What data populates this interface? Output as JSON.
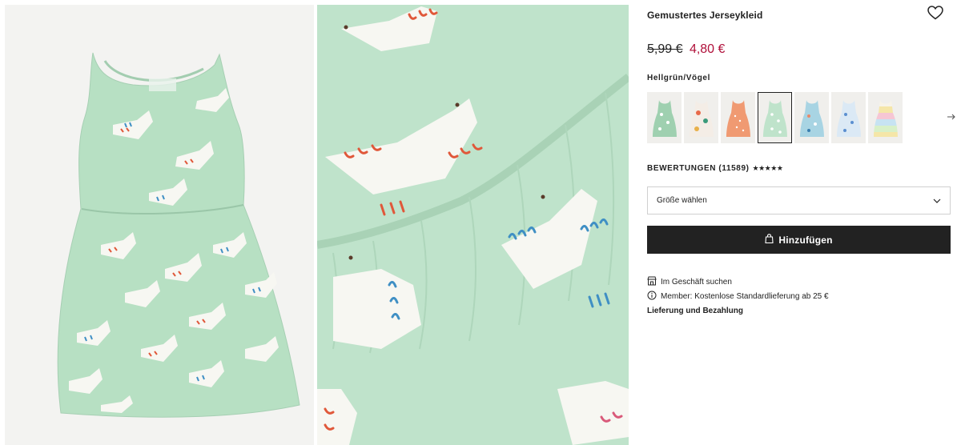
{
  "product": {
    "title": "Gemustertes Jerseykleid",
    "price_old": "5,99 €",
    "price_new": "4,80 €",
    "color_label": "Hellgrün/Vögel"
  },
  "colors": {
    "mint": "#bfe3cb",
    "price_sale": "#b0103a",
    "button_bg": "#222222"
  },
  "swatches": [
    {
      "name": "green-birds-alt",
      "color": "#9fd0b0",
      "active": false
    },
    {
      "name": "white-print",
      "color": "#f4ede6",
      "active": false
    },
    {
      "name": "orange-print",
      "color": "#f09a72",
      "active": false
    },
    {
      "name": "mint-birds",
      "color": "#bfe3cb",
      "active": true
    },
    {
      "name": "blue-print",
      "color": "#a8d4e3",
      "active": false
    },
    {
      "name": "light-blue-print",
      "color": "#cfe3f2",
      "active": false
    },
    {
      "name": "rainbow-stripes",
      "color": "#f5e6a8",
      "active": false
    }
  ],
  "reviews": {
    "label": "BEWERTUNGEN (11589)",
    "stars": "★★★★★"
  },
  "size_select": {
    "label": "Größe wählen"
  },
  "add_button": {
    "label": "Hinzufügen"
  },
  "info": {
    "store_search": "Im Geschäft suchen",
    "member_delivery": "Member: Kostenlose Standardlieferung ab 25 €",
    "delivery_payment": "Lieferung und Bezahlung"
  },
  "icons": {
    "wishlist": "heart-icon",
    "next": "arrow-right-icon",
    "chevron": "chevron-down-icon",
    "bag": "bag-icon",
    "store": "store-icon",
    "info": "info-icon"
  }
}
